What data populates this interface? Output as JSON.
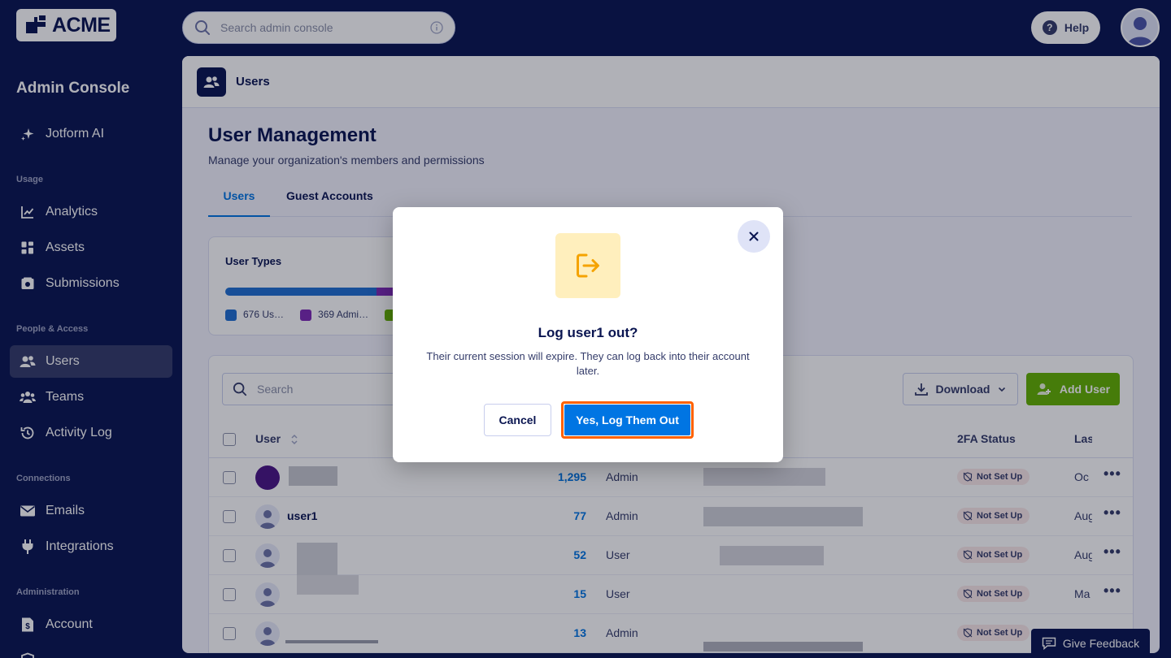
{
  "brand": {
    "logo_text": "ACME"
  },
  "topbar": {
    "search_placeholder": "Search admin console",
    "help_label": "Help",
    "help_glyph": "?"
  },
  "sidebar": {
    "title": "Admin Console",
    "items": [
      {
        "label": "Jotform AI",
        "icon": "sparkle-icon"
      },
      {
        "section": "Usage"
      },
      {
        "label": "Analytics",
        "icon": "chart-icon"
      },
      {
        "label": "Assets",
        "icon": "grid-icon"
      },
      {
        "label": "Submissions",
        "icon": "inbox-icon"
      },
      {
        "section": "People & Access"
      },
      {
        "label": "Users",
        "icon": "users-icon",
        "active": true
      },
      {
        "label": "Teams",
        "icon": "teams-icon"
      },
      {
        "label": "Activity Log",
        "icon": "history-icon"
      },
      {
        "section": "Connections"
      },
      {
        "label": "Emails",
        "icon": "mail-icon"
      },
      {
        "label": "Integrations",
        "icon": "plug-icon"
      },
      {
        "section": "Administration"
      },
      {
        "label": "Account",
        "icon": "account-icon"
      }
    ],
    "sections": [
      "Usage",
      "People & Access",
      "Connections",
      "Administration"
    ]
  },
  "main": {
    "header_title": "Users",
    "page_title": "User Management",
    "page_subtitle": "Manage your organization's members and permissions",
    "tabs": [
      {
        "label": "Users",
        "active": true
      },
      {
        "label": "Guest Accounts",
        "active": false
      }
    ],
    "user_types": {
      "title": "User Types",
      "legend": [
        {
          "label": "676 Us…",
          "color": "#1f6fd1"
        },
        {
          "label": "369 Admi…",
          "color": "#7e2ab6"
        },
        {
          "label": "",
          "color": "#64b200"
        }
      ]
    },
    "table": {
      "search_placeholder": "Search",
      "download_label": "Download",
      "add_user_label": "Add User",
      "headers": {
        "user": "User",
        "twofa": "2FA Status",
        "last": "Las"
      },
      "rows": [
        {
          "name": "",
          "count": "1,295",
          "role": "Admin",
          "twofa": "Not Set Up",
          "last": "Oc",
          "avatar": "purple"
        },
        {
          "name": "user1",
          "count": "77",
          "role": "Admin",
          "twofa": "Not Set Up",
          "last": "Aug",
          "avatar": "default"
        },
        {
          "name": "",
          "count": "52",
          "role": "User",
          "twofa": "Not Set Up",
          "last": "Aug",
          "avatar": "default"
        },
        {
          "name": "",
          "count": "15",
          "role": "User",
          "twofa": "Not Set Up",
          "last": "Ma",
          "avatar": "default"
        },
        {
          "name": "",
          "count": "13",
          "role": "Admin",
          "twofa": "Not Set Up",
          "last": "",
          "avatar": "default"
        }
      ],
      "more_glyph": "•••"
    }
  },
  "modal": {
    "title": "Log user1 out?",
    "body": "Their current session will expire. They can log back into their account later.",
    "cancel_label": "Cancel",
    "confirm_label": "Yes, Log Them Out",
    "icon": "logout-icon",
    "close_icon": "close-icon"
  },
  "feedback": {
    "label": "Give Feedback"
  },
  "colors": {
    "navy": "#0a1551",
    "primary_blue": "#0075e3",
    "green": "#64b200",
    "focus_orange": "#ff6100",
    "modal_icon_bg": "#ffefbd",
    "modal_icon_fg": "#f5a300"
  }
}
